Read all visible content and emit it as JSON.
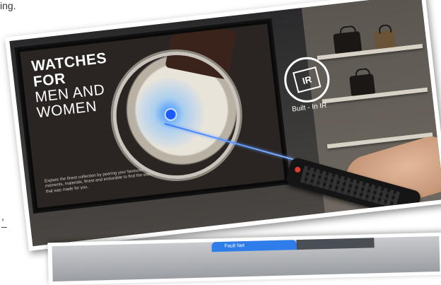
{
  "edge_fragments": {
    "top_left": "ing.",
    "mid_left": ",",
    "mid_left_2": "–"
  },
  "tv": {
    "headline_line1": "WATCHES",
    "headline_line2": "FOR",
    "headline_line3": "MEN AND",
    "headline_line4": "WOMEN",
    "caption": "Explore the finest collection by peering your favourite moments, materials, finest and endurable to find the watch that was made for you."
  },
  "ir_badge": {
    "icon_text": "IR",
    "label": "Built - In IR"
  },
  "bottom_panel": {
    "tab_text": "Fault Net"
  }
}
